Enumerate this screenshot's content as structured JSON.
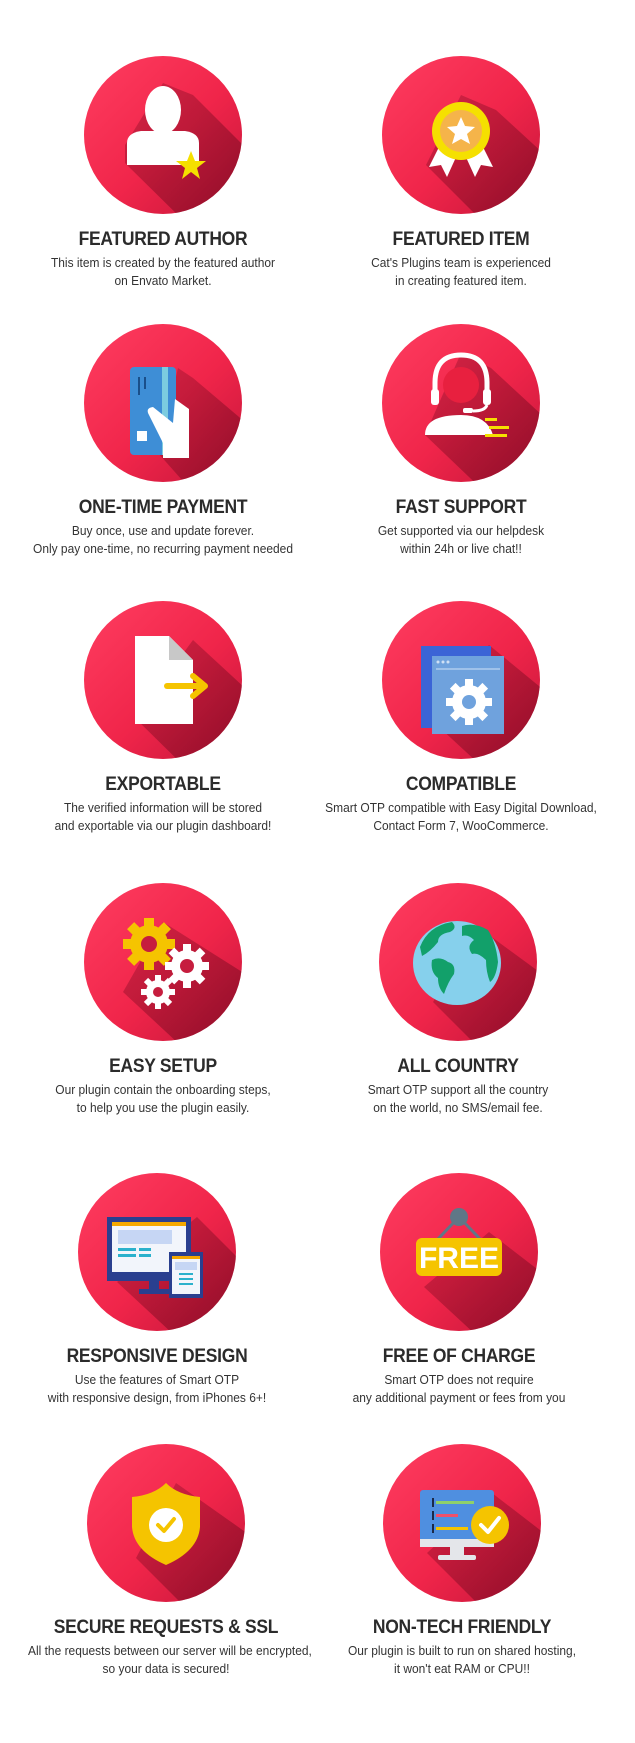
{
  "colors": {
    "circle_light": "#ff3a5c",
    "circle_dark": "#c8173a",
    "shadow": "#7a0a22",
    "title": "#2b2b2b",
    "text": "#333333",
    "yellow": "#f7d600"
  },
  "features": [
    {
      "title": "FEATURED AUTHOR",
      "icon": "user-star-icon",
      "lines": [
        "This item is created by the featured author",
        "on Envato Market."
      ]
    },
    {
      "title": "FEATURED ITEM",
      "icon": "award-badge-icon",
      "lines": [
        "Cat's Plugins team is experienced",
        "in creating featured item."
      ]
    },
    {
      "title": "ONE-TIME PAYMENT",
      "icon": "credit-card-hand-icon",
      "lines": [
        "Buy once, use and update forever.",
        "Only pay one-time, no recurring payment needed"
      ]
    },
    {
      "title": "FAST SUPPORT",
      "icon": "headset-support-icon",
      "lines": [
        "Get supported via our helpdesk",
        "within 24h or live chat!!"
      ]
    },
    {
      "title": "EXPORTABLE",
      "icon": "file-export-icon",
      "lines": [
        "The verified information will be stored",
        "and exportable via our plugin dashboard!"
      ]
    },
    {
      "title": "COMPATIBLE",
      "icon": "window-gear-icon",
      "lines": [
        "Smart OTP compatible with Easy Digital Download,",
        "Contact Form 7, WooCommerce."
      ]
    },
    {
      "title": "EASY SETUP",
      "icon": "gears-icon",
      "lines": [
        "Our plugin contain the onboarding steps,",
        "to help you use the plugin easily."
      ]
    },
    {
      "title": "ALL COUNTRY",
      "icon": "globe-icon",
      "lines": [
        "Smart OTP support all the country",
        "on the world, no SMS/email fee."
      ]
    },
    {
      "title": "RESPONSIVE DESIGN",
      "icon": "responsive-devices-icon",
      "lines": [
        "Use the features of Smart OTP",
        "with responsive design, from iPhones 6+!"
      ]
    },
    {
      "title": "FREE OF CHARGE",
      "icon": "free-sign-icon",
      "lines": [
        "Smart OTP does not require",
        "any additional payment or fees from you"
      ]
    },
    {
      "title": "SECURE REQUESTS & SSL",
      "icon": "shield-check-icon",
      "lines": [
        "All the requests between our server will be encrypted,",
        "so your data is secured!"
      ]
    },
    {
      "title": "NON-TECH FRIENDLY",
      "icon": "monitor-check-icon",
      "lines": [
        "Our plugin is built to run on shared hosting,",
        "it won't eat RAM or CPU!!"
      ]
    }
  ],
  "free_sign_text": "FREE"
}
